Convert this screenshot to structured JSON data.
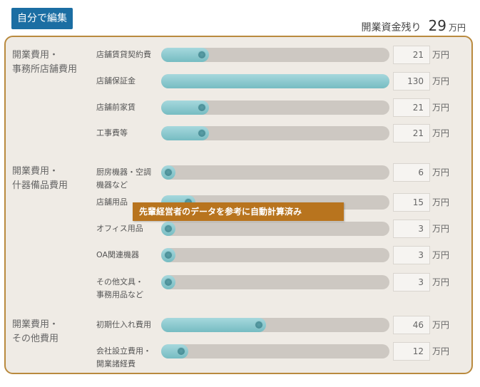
{
  "edit_button": "自分で編集",
  "remaining": {
    "label": "開業資金残り",
    "value": "29",
    "unit": "万円"
  },
  "unit": "万円",
  "tooltip": "先輩経営者のデータを参考に自動計算済み",
  "groups": [
    {
      "label_lines": [
        "開業費用・",
        "事務所店舗費用"
      ]
    },
    {
      "label_lines": [
        "開業費用・",
        "什器備品費用"
      ]
    },
    {
      "label_lines": [
        "開業費用・",
        "その他費用"
      ]
    }
  ],
  "rows": [
    {
      "label_lines": [
        "店舗賃貸契約費"
      ],
      "value": "21",
      "fill": 0.21
    },
    {
      "label_lines": [
        "店舗保証金"
      ],
      "value": "130",
      "fill": 1.0
    },
    {
      "label_lines": [
        "店舗前家賃"
      ],
      "value": "21",
      "fill": 0.21
    },
    {
      "label_lines": [
        "工事費等"
      ],
      "value": "21",
      "fill": 0.21
    },
    {
      "label_lines": [
        "厨房機器・空調",
        "機器など"
      ],
      "value": "6",
      "fill": 0.06
    },
    {
      "label_lines": [
        "店舗用品"
      ],
      "value": "15",
      "fill": 0.15
    },
    {
      "label_lines": [
        "オフィス用品"
      ],
      "value": "3",
      "fill": 0.03
    },
    {
      "label_lines": [
        "OA関連機器"
      ],
      "value": "3",
      "fill": 0.03
    },
    {
      "label_lines": [
        "その他文具・",
        "事務用品など"
      ],
      "value": "3",
      "fill": 0.03
    },
    {
      "label_lines": [
        "初期仕入れ費用"
      ],
      "value": "46",
      "fill": 0.46
    },
    {
      "label_lines": [
        "会社設立費用・",
        "開業諸経費"
      ],
      "value": "12",
      "fill": 0.12
    }
  ]
}
